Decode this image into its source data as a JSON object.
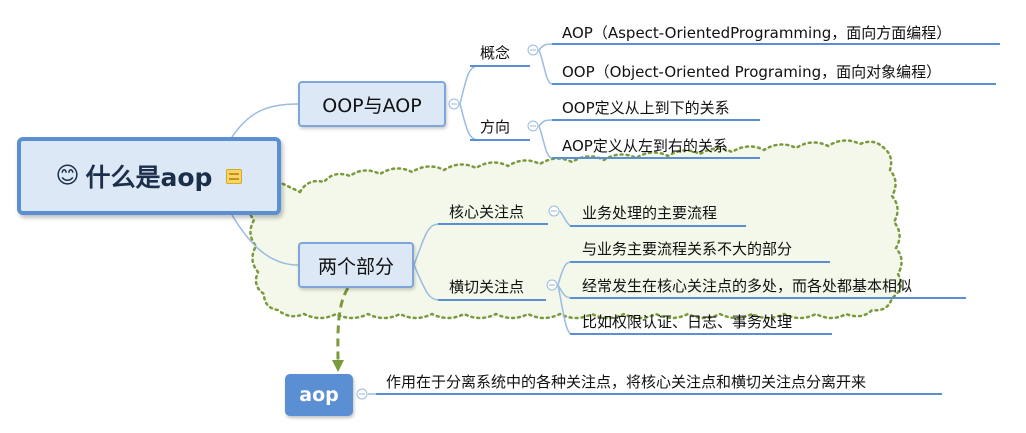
{
  "root": {
    "title": "什么是aop"
  },
  "branches": [
    {
      "label": "OOP与AOP"
    },
    {
      "label": "两个部分"
    }
  ],
  "oop_aop": {
    "concept": {
      "label": "概念",
      "items": [
        "AOP（Aspect-OrientedProgramming，面向方面编程）",
        "OOP（Object-Oriented Programing，面向对象编程）"
      ]
    },
    "direction": {
      "label": "方向",
      "items": [
        "OOP定义从上到下的关系",
        "AOP定义从左到右的关系"
      ]
    }
  },
  "two_parts": {
    "core": {
      "label": "核心关注点",
      "items": [
        "业务处理的主要流程"
      ]
    },
    "crosscut": {
      "label": "横切关注点",
      "items": [
        "与业务主要流程关系不大的部分",
        "经常发生在核心关注点的多处，而各处都基本相似",
        "比如权限认证、日志、事务处理"
      ]
    }
  },
  "aop_node": {
    "label": "aop",
    "description": "作用在于分离系统中的各种关注点，将核心关注点和横切关注点分离开来"
  },
  "colors": {
    "accent": "#5b8fd4",
    "node_fill": "#dde8f6",
    "boundary_fill": "#f3f8ea",
    "boundary_stroke": "#7a9a3c",
    "link": "#9bbbe0"
  }
}
